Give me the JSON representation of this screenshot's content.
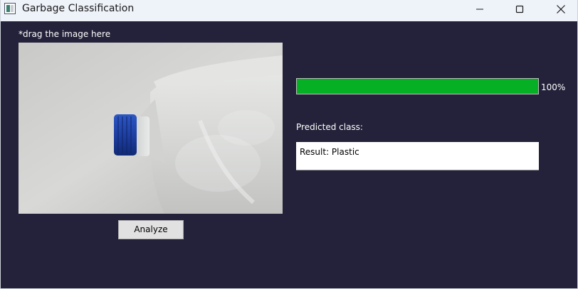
{
  "window": {
    "title": "Garbage Classification",
    "controls": {
      "minimize_icon": "minimize-icon",
      "maximize_icon": "maximize-icon",
      "close_icon": "close-icon"
    }
  },
  "image_panel": {
    "hint": "*drag the image here",
    "image_subject": "plastic-jug-photo"
  },
  "analyze_button": {
    "label": "Analyze"
  },
  "progress": {
    "value_percent": 100,
    "label": "100%",
    "color": "#06b025"
  },
  "prediction": {
    "label": "Predicted class:",
    "result_text": "Result: Plastic"
  },
  "colors": {
    "background": "#24223a",
    "titlebar": "#eef2f9"
  }
}
